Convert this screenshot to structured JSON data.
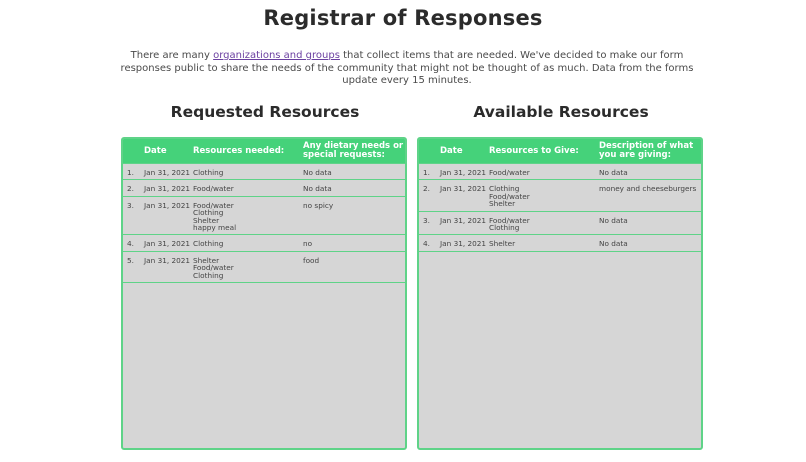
{
  "page": {
    "title": "Registrar of Responses",
    "intro_before_link": "There are many ",
    "intro_link": "organizations and groups",
    "intro_after_link": " that collect items that are needed. We've decided to make our form responses public to share the needs of the community that might not be thought of as much. Data from the forms update every 15 minutes."
  },
  "requested": {
    "title": "Requested Resources",
    "headers": {
      "date": "Date",
      "resources": "Resources needed:",
      "description": "Any dietary needs or special requests:"
    },
    "rows": [
      {
        "num": "1.",
        "date": "Jan 31, 2021",
        "resources": "Clothing",
        "description": "No data",
        "lines": 1
      },
      {
        "num": "2.",
        "date": "Jan 31, 2021",
        "resources": "Food/water",
        "description": "No data",
        "lines": 1
      },
      {
        "num": "3.",
        "date": "Jan 31, 2021",
        "resources": "Food/water\nClothing\nShelter\nhappy meal",
        "description": "no spicy",
        "lines": 4
      },
      {
        "num": "4.",
        "date": "Jan 31, 2021",
        "resources": "Clothing",
        "description": "no",
        "lines": 1
      },
      {
        "num": "5.",
        "date": "Jan 31, 2021",
        "resources": "Shelter\nFood/water\nClothing",
        "description": "food",
        "lines": 3
      }
    ]
  },
  "available": {
    "title": "Available Resources",
    "headers": {
      "date": "Date",
      "resources": "Resources to Give:",
      "description": "Description of what you are giving:"
    },
    "rows": [
      {
        "num": "1.",
        "date": "Jan 31, 2021",
        "resources": "Food/water",
        "description": "No data",
        "lines": 1
      },
      {
        "num": "2.",
        "date": "Jan 31, 2021",
        "resources": "Clothing\nFood/water\nShelter",
        "description": "money and cheeseburgers",
        "lines": 3
      },
      {
        "num": "3.",
        "date": "Jan 31, 2021",
        "resources": "Food/water\nClothing",
        "description": "No data",
        "lines": 2
      },
      {
        "num": "4.",
        "date": "Jan 31, 2021",
        "resources": "Shelter",
        "description": "No data",
        "lines": 1
      }
    ]
  }
}
